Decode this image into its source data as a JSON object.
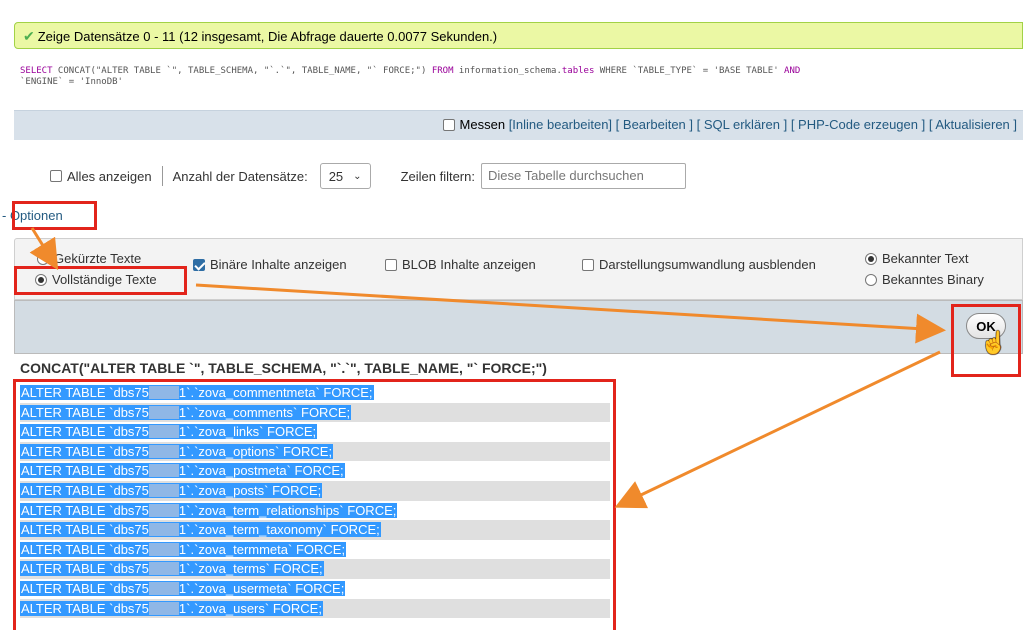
{
  "success_message": "Zeige Datensätze 0 - 11 (12 insgesamt, Die Abfrage dauerte 0.0077 Sekunden.)",
  "sql": {
    "kw1": "SELECT",
    "part1": " CONCAT(\"ALTER TABLE `\", TABLE_SCHEMA, \"`.`\", TABLE_NAME, \"` FORCE;\") ",
    "kw2": "FROM",
    "part2": " information_schema.",
    "tables": "tables",
    "part3": " WHERE `TABLE_TYPE` = 'BASE TABLE' ",
    "kw3": "AND",
    "part4": "\n`ENGINE` = 'InnoDB'"
  },
  "toolbar": {
    "messen": "Messen",
    "links": [
      "[Inline bearbeiten]",
      "[ Bearbeiten ]",
      "[ SQL erklären ]",
      "[ PHP-Code erzeugen ]",
      "[ Aktualisieren ]"
    ]
  },
  "nav": {
    "show_all": "Alles anzeigen",
    "row_count_label": "Anzahl der Datensätze:",
    "row_count_value": "25",
    "filter_label": "Zeilen filtern:",
    "filter_placeholder": "Diese Tabelle durchsuchen"
  },
  "options_link": "- Optionen",
  "options": {
    "short_texts": "Gekürzte Texte",
    "full_texts": "Vollständige Texte",
    "binary": "Binäre Inhalte anzeigen",
    "blob": "BLOB Inhalte anzeigen",
    "transform": "Darstellungsumwandlung ausblenden",
    "known_text": "Bekannter Text",
    "known_binary": "Bekanntes Binary"
  },
  "ok_label": "OK",
  "column_header": "CONCAT(\"ALTER TABLE `\", TABLE_SCHEMA, \"`.`\", TABLE_NAME, \"` FORCE;\")",
  "rows": [
    {
      "prefix": "ALTER TABLE `dbs75",
      "suffix": "1`.`zova_commentmeta` FORCE;"
    },
    {
      "prefix": "ALTER TABLE `dbs75",
      "suffix": "1`.`zova_comments` FORCE;"
    },
    {
      "prefix": "ALTER TABLE `dbs75",
      "suffix": "1`.`zova_links` FORCE;"
    },
    {
      "prefix": "ALTER TABLE `dbs75",
      "suffix": "1`.`zova_options` FORCE;"
    },
    {
      "prefix": "ALTER TABLE `dbs75",
      "suffix": "1`.`zova_postmeta` FORCE;"
    },
    {
      "prefix": "ALTER TABLE `dbs75",
      "suffix": "1`.`zova_posts` FORCE;"
    },
    {
      "prefix": "ALTER TABLE `dbs75",
      "suffix": "1`.`zova_term_relationships` FORCE;"
    },
    {
      "prefix": "ALTER TABLE `dbs75",
      "suffix": "1`.`zova_term_taxonomy` FORCE;"
    },
    {
      "prefix": "ALTER TABLE `dbs75",
      "suffix": "1`.`zova_termmeta` FORCE;"
    },
    {
      "prefix": "ALTER TABLE `dbs75",
      "suffix": "1`.`zova_terms` FORCE;"
    },
    {
      "prefix": "ALTER TABLE `dbs75",
      "suffix": "1`.`zova_usermeta` FORCE;"
    },
    {
      "prefix": "ALTER TABLE `dbs75",
      "suffix": "1`.`zova_users` FORCE;"
    }
  ],
  "colors": {
    "success_bg": "#ebf8a4",
    "highlight_red": "#e2241b",
    "arrow_orange": "#f08a2c",
    "selection_blue": "#3399ff",
    "link_blue": "#235a81"
  }
}
